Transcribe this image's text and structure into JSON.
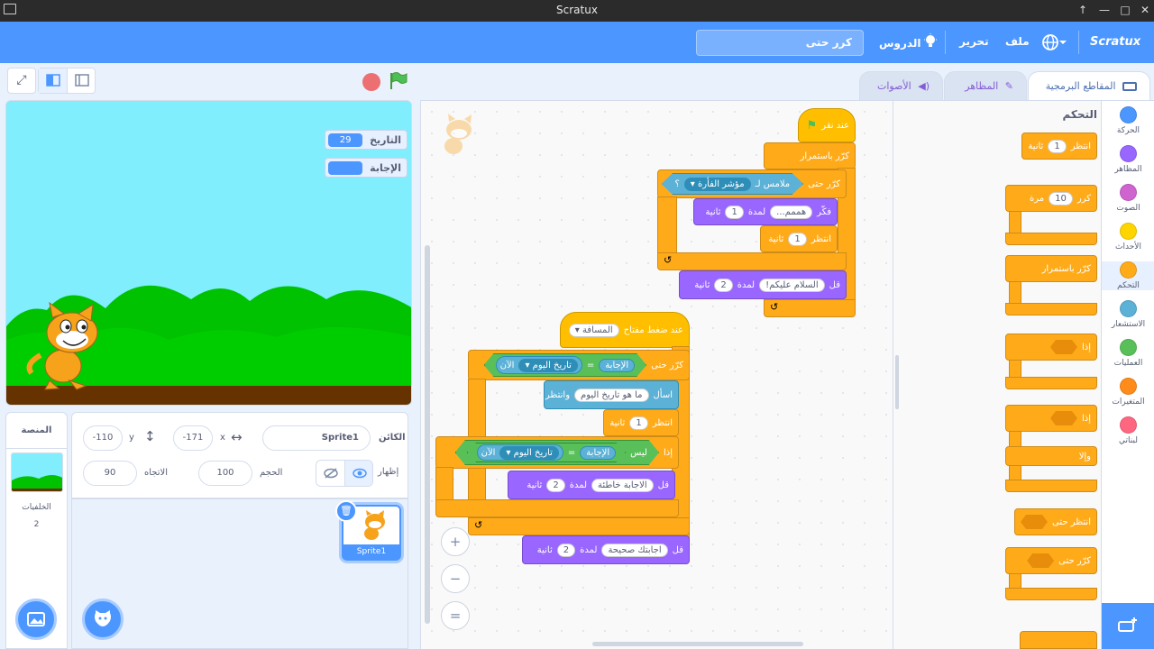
{
  "window": {
    "title": "Scratux"
  },
  "menubar": {
    "brand": "Scratux",
    "file": "ملف",
    "edit": "تحرير",
    "tutorials": "الدروس",
    "project_title": "كرر حتى"
  },
  "tabs": {
    "code": "المقاطع البرمجية",
    "costumes": "المظاهر",
    "sounds": "الأصوات"
  },
  "categories": [
    {
      "label": "الحركة",
      "color": "#4c97ff"
    },
    {
      "label": "المظاهر",
      "color": "#9966ff"
    },
    {
      "label": "الصوت",
      "color": "#cf63cf"
    },
    {
      "label": "الأحداث",
      "color": "#ffd500"
    },
    {
      "label": "التحكم",
      "color": "#ffab19"
    },
    {
      "label": "الاستشعار",
      "color": "#5cb1d6"
    },
    {
      "label": "العمليات",
      "color": "#59c059"
    },
    {
      "label": "المتغيرات",
      "color": "#ff8c1a"
    },
    {
      "label": "لبناتي",
      "color": "#ff6680"
    }
  ],
  "palette": {
    "heading": "التحكم",
    "wait": "انتظر",
    "wait_value": "1",
    "seconds": "ثانية",
    "repeat": "كرر",
    "repeat_value": "10",
    "times": "مرة",
    "forever": "كرّر باستمرار",
    "if": "إذا",
    "else": "وإلا",
    "wait_until": "انتظر حتى",
    "repeat_until": "كرّر حتى"
  },
  "script1": {
    "when_flag": "عند نقر",
    "forever": "كرّر باستمرار",
    "repeat_until": "كرّر حتى",
    "touching": "ملامس لـ",
    "mouse_pointer": "مؤشر الفأرة",
    "question_mark": "؟",
    "think": "فكّر",
    "think_text": "هممم...",
    "for": "لمدة",
    "think_secs": "1",
    "seconds": "ثانية",
    "wait": "انتظر",
    "wait_value": "1",
    "say": "قل",
    "say_text": "السلام عليكم!",
    "say_secs": "2"
  },
  "script2": {
    "when_key": "عند ضغط مفتاح",
    "key": "المسافة",
    "repeat_until": "كرّر حتى",
    "answer": "الإجابة",
    "equals": "=",
    "current": "الآن",
    "date_today": "تاريخ اليوم",
    "ask": "اسأل",
    "ask_text": "ما هو تاريخ اليوم",
    "and_wait": "وانتظر",
    "wait": "انتظر",
    "wait_value": "1",
    "seconds": "ثانية",
    "if": "إذا",
    "not": "ليس",
    "say": "قل",
    "say_wrong": "الاجابة خاطئة",
    "for": "لمدة",
    "secs": "2",
    "say_right": "اجابتك صحيحة"
  },
  "stage": {
    "monitor_date_label": "التاريخ",
    "monitor_date_value": "29",
    "monitor_answer_label": "الإجابة",
    "monitor_answer_value": ""
  },
  "sprite_info": {
    "sprite_label": "الكائن",
    "sprite_name": "Sprite1",
    "x_label": "x",
    "x_value": "-171",
    "y_label": "y",
    "y_value": "-110",
    "show_label": "إظهار",
    "size_label": "الحجم",
    "size_value": "100",
    "direction_label": "الاتجاه",
    "direction_value": "90"
  },
  "sprites": [
    {
      "name": "Sprite1"
    }
  ],
  "stage_pane": {
    "title": "المنصة",
    "backdrops_label": "الخلفيات",
    "backdrops_count": "2"
  }
}
